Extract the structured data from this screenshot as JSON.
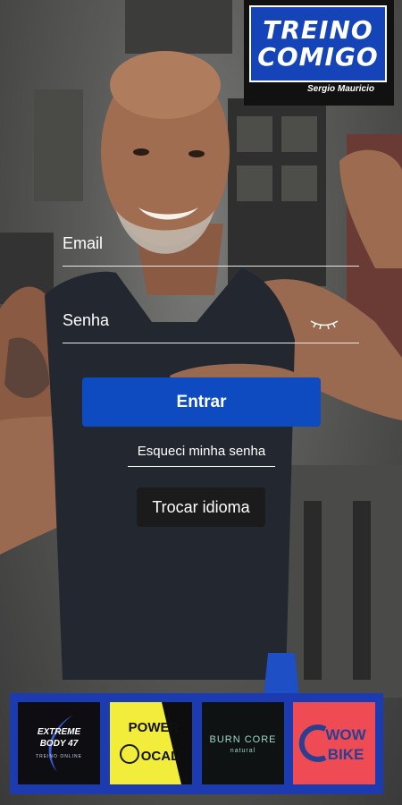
{
  "header": {
    "logo_line1": "TREINO",
    "logo_line2": "COMIGO",
    "logo_sub": "Sergio Mauricio"
  },
  "form": {
    "email_label": "Email",
    "password_label": "Senha",
    "submit_label": "Entrar",
    "forgot_label": "Esqueci minha senha",
    "language_label": "Trocar idioma"
  },
  "sponsors": [
    {
      "line1": "EXTREME",
      "line2": "BODY 47",
      "line3": "TREINO ONLINE"
    },
    {
      "line1": "POWER",
      "line2": "OCAL"
    },
    {
      "line1": "BURN CORE",
      "line2": "natural"
    },
    {
      "line1": "WOW",
      "line2": "BIKE"
    }
  ],
  "colors": {
    "accent": "#0f4bc0",
    "sponsor_bar": "#1c3bb0",
    "power_yellow": "#f2ec3a",
    "wow_red": "#ee4b55"
  }
}
